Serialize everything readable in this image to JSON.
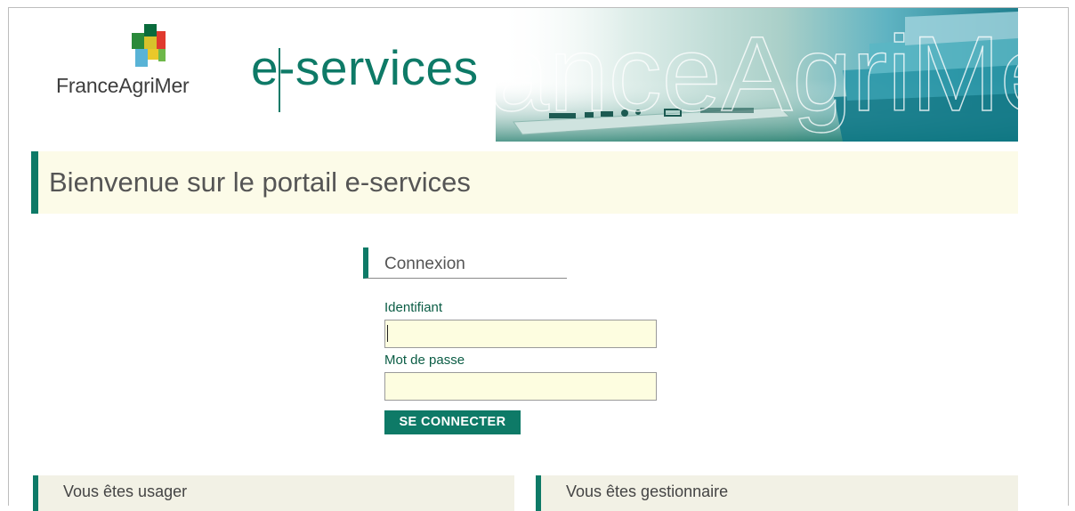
{
  "header": {
    "brand": "FranceAgriMer",
    "product": "e-services",
    "banner_watermark": "FranceAgriMer"
  },
  "welcome": {
    "title": "Bienvenue sur le portail e-services"
  },
  "login": {
    "title": "Connexion",
    "username_label": "Identifiant",
    "username_value": "",
    "password_label": "Mot de passe",
    "password_value": "",
    "submit_label": "SE CONNECTER"
  },
  "sections": {
    "user": "Vous êtes usager",
    "manager": "Vous êtes gestionnaire"
  },
  "colors": {
    "accent": "#0e7a67",
    "panel_bg": "#fcfbe8",
    "input_bg": "#fdfde0"
  }
}
